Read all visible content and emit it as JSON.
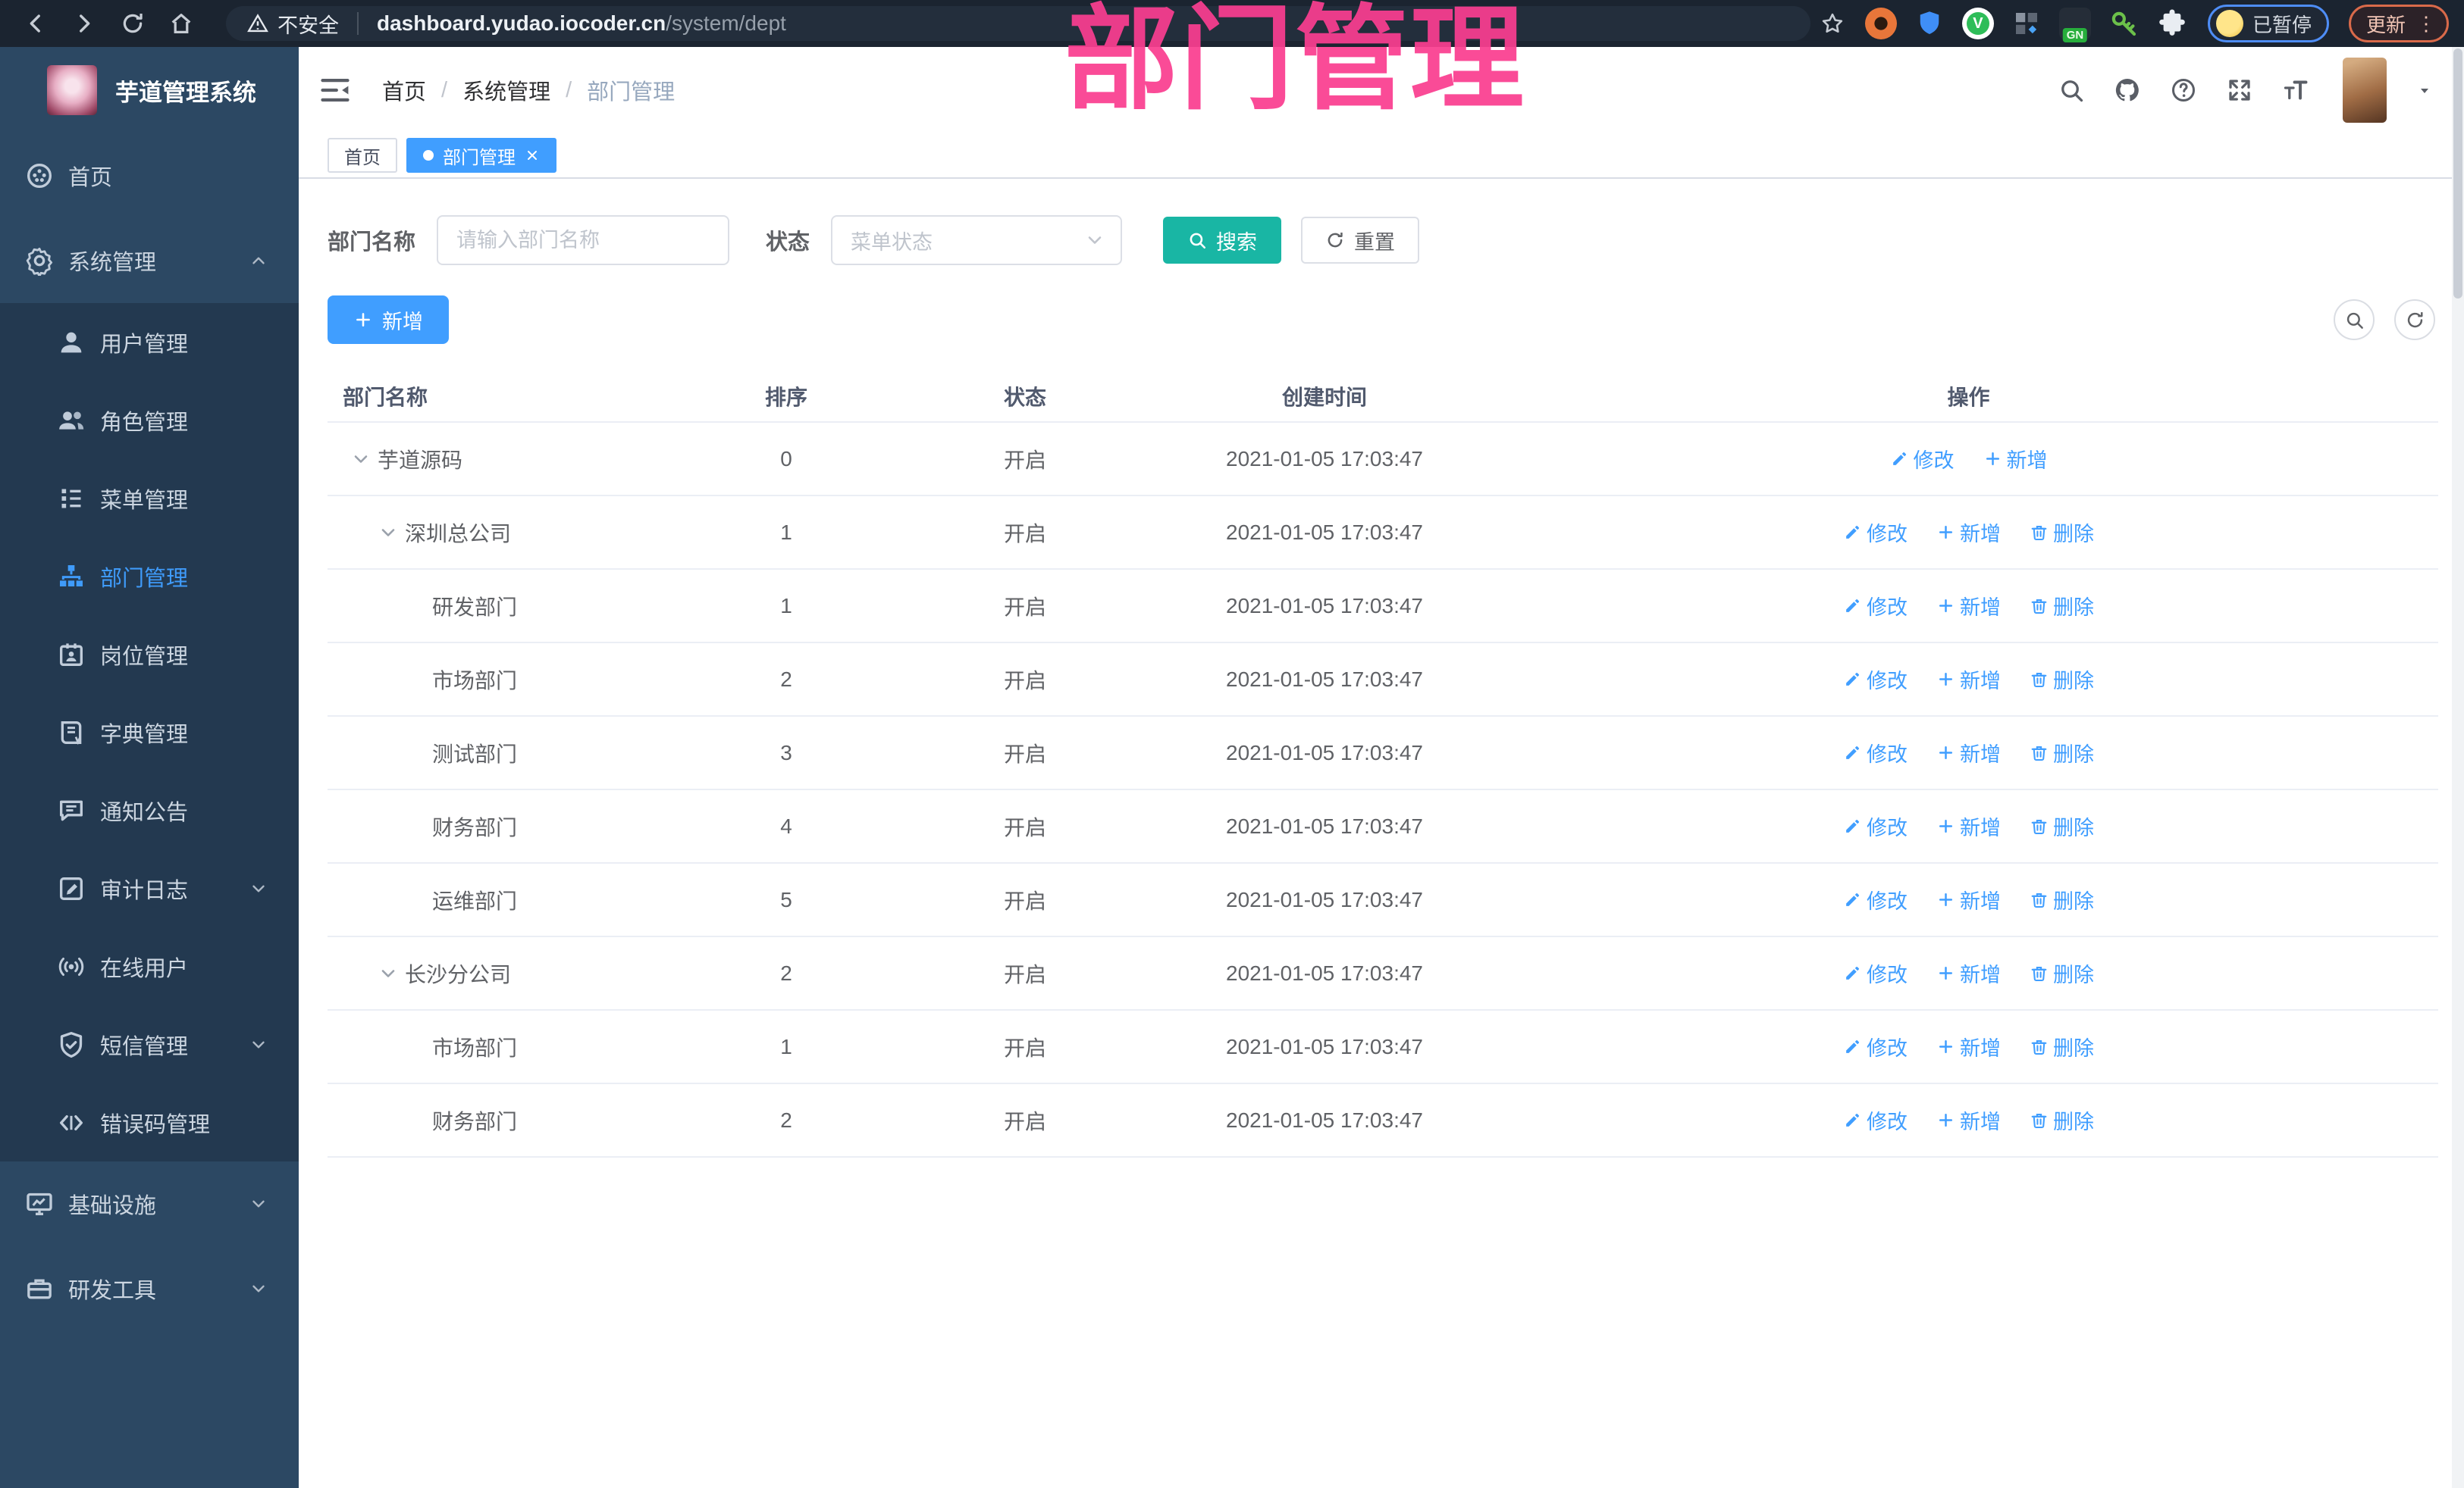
{
  "browser": {
    "security_label": "不安全",
    "url_domain": "dashboard.yudao.iocoder.cn",
    "url_path": "/system/dept",
    "extensions": [
      {
        "key": "orange-ring",
        "label": ""
      },
      {
        "key": "blue-shield",
        "label": ""
      },
      {
        "key": "green-check",
        "label": "V"
      },
      {
        "key": "grid",
        "label": ""
      },
      {
        "key": "gn",
        "label": "GN"
      },
      {
        "key": "green-key",
        "label": ""
      },
      {
        "key": "puzzle",
        "label": ""
      }
    ],
    "profile_label": "已暂停",
    "update_label": "更新",
    "menu_dots": "⋮"
  },
  "overlay_title": "部门管理",
  "sidebar": {
    "app_title": "芋道管理系统",
    "items": [
      {
        "key": "home",
        "label": "首页",
        "icon": "dashboard",
        "type": "top",
        "chevron": "",
        "active": false
      },
      {
        "key": "system",
        "label": "系统管理",
        "icon": "gear",
        "type": "top",
        "chevron": "up",
        "active": false
      },
      {
        "key": "user",
        "label": "用户管理",
        "icon": "user",
        "type": "sub",
        "chevron": "",
        "active": false
      },
      {
        "key": "role",
        "label": "角色管理",
        "icon": "users",
        "type": "sub",
        "chevron": "",
        "active": false
      },
      {
        "key": "menu",
        "label": "菜单管理",
        "icon": "menu-tree",
        "type": "sub",
        "chevron": "",
        "active": false
      },
      {
        "key": "dept",
        "label": "部门管理",
        "icon": "org-chart",
        "type": "sub",
        "chevron": "",
        "active": true
      },
      {
        "key": "post",
        "label": "岗位管理",
        "icon": "badge",
        "type": "sub",
        "chevron": "",
        "active": false
      },
      {
        "key": "dict",
        "label": "字典管理",
        "icon": "book",
        "type": "sub",
        "chevron": "",
        "active": false
      },
      {
        "key": "notice",
        "label": "通知公告",
        "icon": "announcement",
        "type": "sub",
        "chevron": "",
        "active": false
      },
      {
        "key": "audit",
        "label": "审计日志",
        "icon": "audit-log",
        "type": "sub",
        "chevron": "down",
        "active": false
      },
      {
        "key": "online",
        "label": "在线用户",
        "icon": "online-user",
        "type": "sub",
        "chevron": "",
        "active": false
      },
      {
        "key": "sms",
        "label": "短信管理",
        "icon": "shield-check",
        "type": "sub",
        "chevron": "down",
        "active": false
      },
      {
        "key": "errcode",
        "label": "错误码管理",
        "icon": "code",
        "type": "sub",
        "chevron": "",
        "active": false
      },
      {
        "key": "infra",
        "label": "基础设施",
        "icon": "monitor",
        "type": "top",
        "chevron": "down",
        "active": false
      },
      {
        "key": "tools",
        "label": "研发工具",
        "icon": "toolbox",
        "type": "top",
        "chevron": "down",
        "active": false
      }
    ]
  },
  "header": {
    "breadcrumb": [
      "首页",
      "系统管理",
      "部门管理"
    ]
  },
  "tabs": [
    {
      "label": "首页",
      "active": false,
      "closable": false
    },
    {
      "label": "部门管理",
      "active": true,
      "closable": true
    }
  ],
  "filters": {
    "dept_label": "部门名称",
    "dept_placeholder": "请输入部门名称",
    "status_label": "状态",
    "status_placeholder": "菜单状态",
    "search_label": "搜索",
    "reset_label": "重置"
  },
  "toolbar": {
    "add_label": "新增"
  },
  "table": {
    "columns": [
      "部门名称",
      "排序",
      "状态",
      "创建时间",
      "操作"
    ],
    "rows": [
      {
        "name": "芋道源码",
        "level": 0,
        "expandable": true,
        "sort": "0",
        "status": "开启",
        "created": "2021-01-05 17:03:47",
        "actions": [
          {
            "icon": "edit",
            "label": "修改"
          },
          {
            "icon": "plus",
            "label": "新增"
          }
        ]
      },
      {
        "name": "深圳总公司",
        "level": 1,
        "expandable": true,
        "sort": "1",
        "status": "开启",
        "created": "2021-01-05 17:03:47",
        "actions": [
          {
            "icon": "edit",
            "label": "修改"
          },
          {
            "icon": "plus",
            "label": "新增"
          },
          {
            "icon": "trash",
            "label": "删除"
          }
        ]
      },
      {
        "name": "研发部门",
        "level": 2,
        "expandable": false,
        "sort": "1",
        "status": "开启",
        "created": "2021-01-05 17:03:47",
        "actions": [
          {
            "icon": "edit",
            "label": "修改"
          },
          {
            "icon": "plus",
            "label": "新增"
          },
          {
            "icon": "trash",
            "label": "删除"
          }
        ]
      },
      {
        "name": "市场部门",
        "level": 2,
        "expandable": false,
        "sort": "2",
        "status": "开启",
        "created": "2021-01-05 17:03:47",
        "actions": [
          {
            "icon": "edit",
            "label": "修改"
          },
          {
            "icon": "plus",
            "label": "新增"
          },
          {
            "icon": "trash",
            "label": "删除"
          }
        ]
      },
      {
        "name": "测试部门",
        "level": 2,
        "expandable": false,
        "sort": "3",
        "status": "开启",
        "created": "2021-01-05 17:03:47",
        "actions": [
          {
            "icon": "edit",
            "label": "修改"
          },
          {
            "icon": "plus",
            "label": "新增"
          },
          {
            "icon": "trash",
            "label": "删除"
          }
        ]
      },
      {
        "name": "财务部门",
        "level": 2,
        "expandable": false,
        "sort": "4",
        "status": "开启",
        "created": "2021-01-05 17:03:47",
        "actions": [
          {
            "icon": "edit",
            "label": "修改"
          },
          {
            "icon": "plus",
            "label": "新增"
          },
          {
            "icon": "trash",
            "label": "删除"
          }
        ]
      },
      {
        "name": "运维部门",
        "level": 2,
        "expandable": false,
        "sort": "5",
        "status": "开启",
        "created": "2021-01-05 17:03:47",
        "actions": [
          {
            "icon": "edit",
            "label": "修改"
          },
          {
            "icon": "plus",
            "label": "新增"
          },
          {
            "icon": "trash",
            "label": "删除"
          }
        ]
      },
      {
        "name": "长沙分公司",
        "level": 1,
        "expandable": true,
        "sort": "2",
        "status": "开启",
        "created": "2021-01-05 17:03:47",
        "actions": [
          {
            "icon": "edit",
            "label": "修改"
          },
          {
            "icon": "plus",
            "label": "新增"
          },
          {
            "icon": "trash",
            "label": "删除"
          }
        ]
      },
      {
        "name": "市场部门",
        "level": 2,
        "expandable": false,
        "sort": "1",
        "status": "开启",
        "created": "2021-01-05 17:03:47",
        "actions": [
          {
            "icon": "edit",
            "label": "修改"
          },
          {
            "icon": "plus",
            "label": "新增"
          },
          {
            "icon": "trash",
            "label": "删除"
          }
        ]
      },
      {
        "name": "财务部门",
        "level": 2,
        "expandable": false,
        "sort": "2",
        "status": "开启",
        "created": "2021-01-05 17:03:47",
        "actions": [
          {
            "icon": "edit",
            "label": "修改"
          },
          {
            "icon": "plus",
            "label": "新增"
          },
          {
            "icon": "trash",
            "label": "删除"
          }
        ]
      }
    ]
  },
  "colors": {
    "accent_blue": "#409eff",
    "search_teal": "#19b6a4",
    "overlay_pink": "#fa3e90",
    "sidebar_bg": "#2c4863",
    "submenu_bg": "#233950",
    "chrome_bg": "#1b2430"
  }
}
